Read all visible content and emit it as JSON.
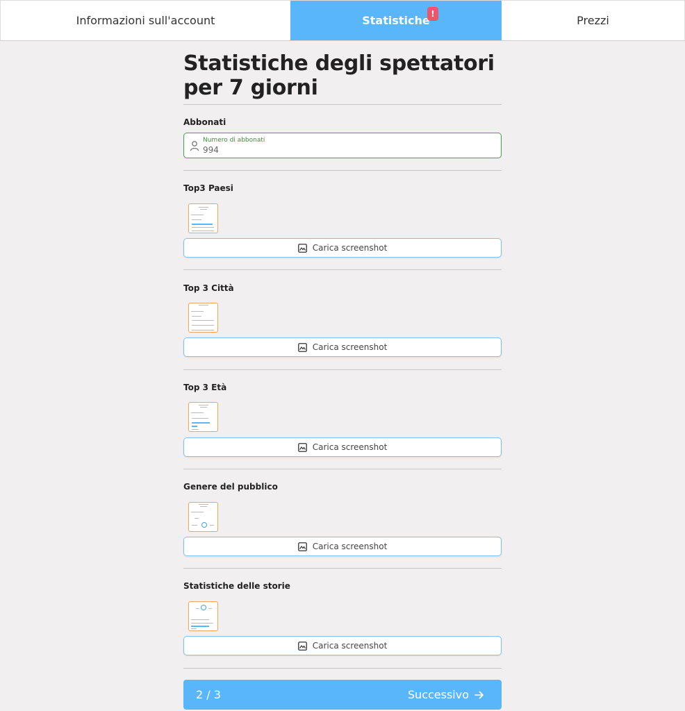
{
  "tabs": [
    {
      "label": "Informazioni sull'account"
    },
    {
      "label": "Statistiche",
      "badge": "!"
    },
    {
      "label": "Prezzi"
    }
  ],
  "page_title": "Statistiche degli spettatori per 7 giorni",
  "subscribers": {
    "label": "Abbonati",
    "field_label": "Numero di abbonati",
    "value": "994"
  },
  "sections": [
    {
      "label": "Top3 Paesi",
      "upload_label": "Carica screenshot"
    },
    {
      "label": "Top 3 Città",
      "upload_label": "Carica screenshot"
    },
    {
      "label": "Top 3 Età",
      "upload_label": "Carica screenshot"
    },
    {
      "label": "Genere del pubblico",
      "upload_label": "Carica screenshot"
    },
    {
      "label": "Statistiche delle storie",
      "upload_label": "Carica screenshot"
    }
  ],
  "footer": {
    "step": "2 / 3",
    "next_label": "Successivo"
  },
  "colors": {
    "accent": "#5ab6fb",
    "badge": "#f0566b",
    "valid": "#3fa53f",
    "thumb_border": "#f5a25a",
    "background": "#f1efef"
  },
  "icons": [
    "person-icon",
    "image-icon",
    "arrow-right-icon"
  ]
}
